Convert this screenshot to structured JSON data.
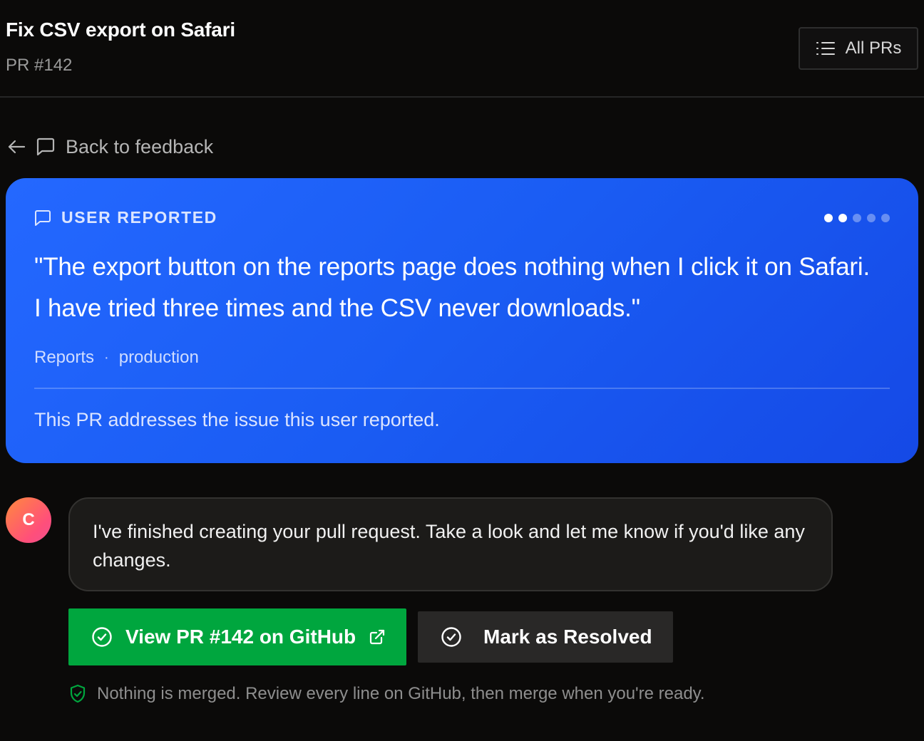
{
  "header": {
    "title": "Fix CSV export on Safari",
    "subtitle": "PR #142",
    "all_prs_label": "All PRs",
    "all_prs_icon": "list-icon"
  },
  "back_link": {
    "label": "Back to feedback",
    "icons": [
      "arrow-left-icon",
      "message-square-icon"
    ]
  },
  "feedback_card": {
    "label": "USER REPORTED",
    "label_icon": "message-square-icon",
    "pagination": {
      "total": 5,
      "active": 2
    },
    "quote": "\"The export button on the reports page does nothing when I click it on Safari. I have tried three times and the CSV never downloads.\"",
    "tags": [
      "Reports",
      "production"
    ],
    "separator": "·",
    "footer": "This PR addresses the issue this user reported.",
    "colors": {
      "background": "#1a5cf3"
    }
  },
  "assistant": {
    "avatar_letter": "C",
    "message": "I've finished creating your pull request. Take a look and let me know if you'd like any changes."
  },
  "actions": {
    "view_pr_label": "View PR #142 on GitHub",
    "view_pr_icons": [
      "check-circle-icon",
      "external-link-icon"
    ],
    "resolve_label": "Mark as Resolved",
    "resolve_icon": "check-circle-icon",
    "colors": {
      "primary": "#00a63e",
      "secondary": "#292827"
    }
  },
  "note": {
    "text": "Nothing is merged. Review every line on GitHub, then merge when you're ready.",
    "icon": "shield-check-icon",
    "icon_color": "#00a63e"
  }
}
